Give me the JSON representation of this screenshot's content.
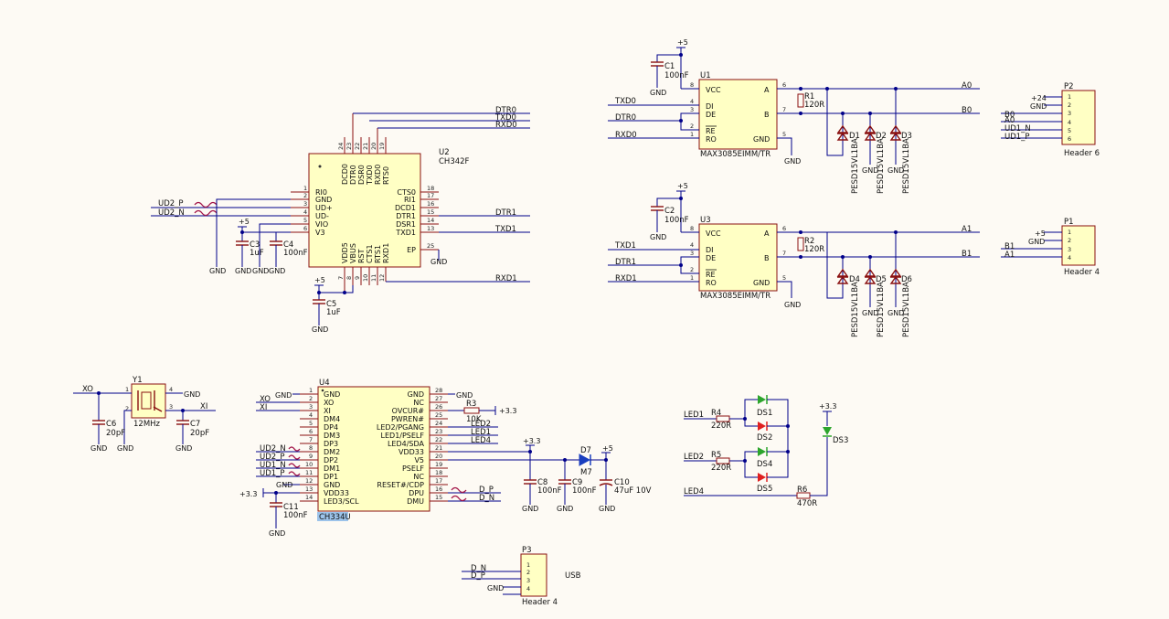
{
  "u2": {
    "ref": "U2",
    "part": "CH342F",
    "left_pins": [
      {
        "num": "1",
        "name": "RI0"
      },
      {
        "num": "2",
        "name": "GND"
      },
      {
        "num": "3",
        "name": "UD+"
      },
      {
        "num": "4",
        "name": "UD-"
      },
      {
        "num": "5",
        "name": "VIO"
      },
      {
        "num": "6",
        "name": "V3"
      }
    ],
    "top_pins": [
      {
        "num": "24",
        "name": "DCD0"
      },
      {
        "num": "23",
        "name": "DTR0"
      },
      {
        "num": "22",
        "name": "DSR0"
      },
      {
        "num": "21",
        "name": "TXD0"
      },
      {
        "num": "20",
        "name": "RXD0"
      },
      {
        "num": "19",
        "name": "RTS0"
      }
    ],
    "right_pins": [
      {
        "num": "18",
        "name": "CTS0"
      },
      {
        "num": "17",
        "name": "RI1"
      },
      {
        "num": "16",
        "name": "DCD1"
      },
      {
        "num": "15",
        "name": "DTR1"
      },
      {
        "num": "14",
        "name": "DSR1"
      },
      {
        "num": "13",
        "name": "TXD1"
      },
      {
        "num": "25",
        "name": "EP"
      }
    ],
    "bottom_pins": [
      {
        "num": "7",
        "name": "VDD5"
      },
      {
        "num": "8",
        "name": "VBUS"
      },
      {
        "num": "9",
        "name": "RST"
      },
      {
        "num": "10",
        "name": "CTS1"
      },
      {
        "num": "11",
        "name": "RTS1"
      },
      {
        "num": "12",
        "name": "RXD1"
      }
    ]
  },
  "u1": {
    "ref": "U1",
    "part": "MAX3085EIMM/TR",
    "pins": [
      {
        "num": "8",
        "name": "VCC"
      },
      {
        "num": "4",
        "name": "DI"
      },
      {
        "num": "3",
        "name": "DE"
      },
      {
        "num": "2",
        "name": "RE"
      },
      {
        "num": "1",
        "name": "RO"
      },
      {
        "num": "6",
        "name": "A"
      },
      {
        "num": "7",
        "name": "B"
      },
      {
        "num": "5",
        "name": "GND"
      }
    ]
  },
  "u3": {
    "ref": "U3",
    "part": "MAX3085EIMM/TR",
    "pins": [
      {
        "num": "8",
        "name": "VCC"
      },
      {
        "num": "4",
        "name": "DI"
      },
      {
        "num": "3",
        "name": "DE"
      },
      {
        "num": "2",
        "name": "RE"
      },
      {
        "num": "1",
        "name": "RO"
      },
      {
        "num": "6",
        "name": "A"
      },
      {
        "num": "7",
        "name": "B"
      },
      {
        "num": "5",
        "name": "GND"
      }
    ]
  },
  "u4": {
    "ref": "U4",
    "part": "CH334U",
    "left_pins": [
      {
        "num": "1",
        "name": "GND"
      },
      {
        "num": "2",
        "name": "XO"
      },
      {
        "num": "3",
        "name": "XI"
      },
      {
        "num": "4",
        "name": "DM4"
      },
      {
        "num": "5",
        "name": "DP4"
      },
      {
        "num": "6",
        "name": "DM3"
      },
      {
        "num": "7",
        "name": "DP3"
      },
      {
        "num": "8",
        "name": "DM2"
      },
      {
        "num": "9",
        "name": "DP2"
      },
      {
        "num": "10",
        "name": "DM1"
      },
      {
        "num": "11",
        "name": "DP1"
      },
      {
        "num": "12",
        "name": "GND"
      },
      {
        "num": "13",
        "name": "VDD33"
      },
      {
        "num": "14",
        "name": "LED3/SCL"
      }
    ],
    "right_pins": [
      {
        "num": "28",
        "name": "GND"
      },
      {
        "num": "27",
        "name": "NC"
      },
      {
        "num": "26",
        "name": "OVCUR#"
      },
      {
        "num": "25",
        "name": "PWREN#"
      },
      {
        "num": "24",
        "name": "LED2/PGANG"
      },
      {
        "num": "23",
        "name": "LED1/PSELF"
      },
      {
        "num": "22",
        "name": "LED4/SDA"
      },
      {
        "num": "21",
        "name": "VDD33"
      },
      {
        "num": "20",
        "name": "V5"
      },
      {
        "num": "19",
        "name": "PSELF"
      },
      {
        "num": "18",
        "name": "NC"
      },
      {
        "num": "17",
        "name": "RESET#/CDP"
      },
      {
        "num": "16",
        "name": "DPU"
      },
      {
        "num": "15",
        "name": "DMU"
      }
    ]
  },
  "headers": {
    "p2": {
      "ref": "P2",
      "label": "Header 6",
      "pins": [
        "1",
        "2",
        "3",
        "4",
        "5",
        "6"
      ]
    },
    "p1": {
      "ref": "P1",
      "label": "Header 4",
      "pins": [
        "1",
        "2",
        "3",
        "4"
      ]
    },
    "p3": {
      "ref": "P3",
      "label": "Header 4",
      "pins": [
        "1",
        "2",
        "3",
        "4"
      ]
    }
  },
  "passives": {
    "c1": {
      "ref": "C1",
      "value": "100nF"
    },
    "c2": {
      "ref": "C2",
      "value": "100nF"
    },
    "c3": {
      "ref": "C3",
      "value": "1uF"
    },
    "c4": {
      "ref": "C4",
      "value": "100nF"
    },
    "c5": {
      "ref": "C5",
      "value": "1uF"
    },
    "c6": {
      "ref": "C6",
      "value": "20pF"
    },
    "c7": {
      "ref": "C7",
      "value": "20pF"
    },
    "c8": {
      "ref": "C8",
      "value": "100nF"
    },
    "c9": {
      "ref": "C9",
      "value": "100nF"
    },
    "c10": {
      "ref": "C10",
      "value": "47uF 10V"
    },
    "c11": {
      "ref": "C11",
      "value": "100nF"
    },
    "r1": {
      "ref": "R1",
      "value": "120R"
    },
    "r2": {
      "ref": "R2",
      "value": "120R"
    },
    "r3": {
      "ref": "R3",
      "value": "10K"
    },
    "r4": {
      "ref": "R4",
      "value": "220R"
    },
    "r5": {
      "ref": "R5",
      "value": "220R"
    },
    "r6": {
      "ref": "R6",
      "value": "470R"
    },
    "y1": {
      "ref": "Y1",
      "value": "12MHz"
    },
    "d7": {
      "ref": "D7",
      "value": "M7"
    },
    "tvs_part": "PESD15VL1BA",
    "tvs_refs": [
      "D1",
      "D2",
      "D3",
      "D4",
      "D5",
      "D6"
    ],
    "leds": [
      "DS1",
      "DS2",
      "DS3",
      "DS4",
      "DS5"
    ]
  },
  "nets": {
    "dtr0": "DTR0",
    "txd0": "TXD0",
    "rxd0": "RXD0",
    "dtr1": "DTR1",
    "txd1": "TXD1",
    "rxd1": "RXD1",
    "ud2p": "UD2_P",
    "ud2n": "UD2_N",
    "ud1p": "UD1_P",
    "ud1n": "UD1_N",
    "a0": "A0",
    "b0": "B0",
    "a1": "A1",
    "b1": "B1",
    "xo": "XO",
    "xi": "XI",
    "dp": "D_P",
    "dn": "D_N",
    "led1": "LED1",
    "led2": "LED2",
    "led4": "LED4",
    "gnd": "GND",
    "p5": "+5",
    "p33": "+3.3",
    "p24": "+24",
    "usb": "USB"
  }
}
